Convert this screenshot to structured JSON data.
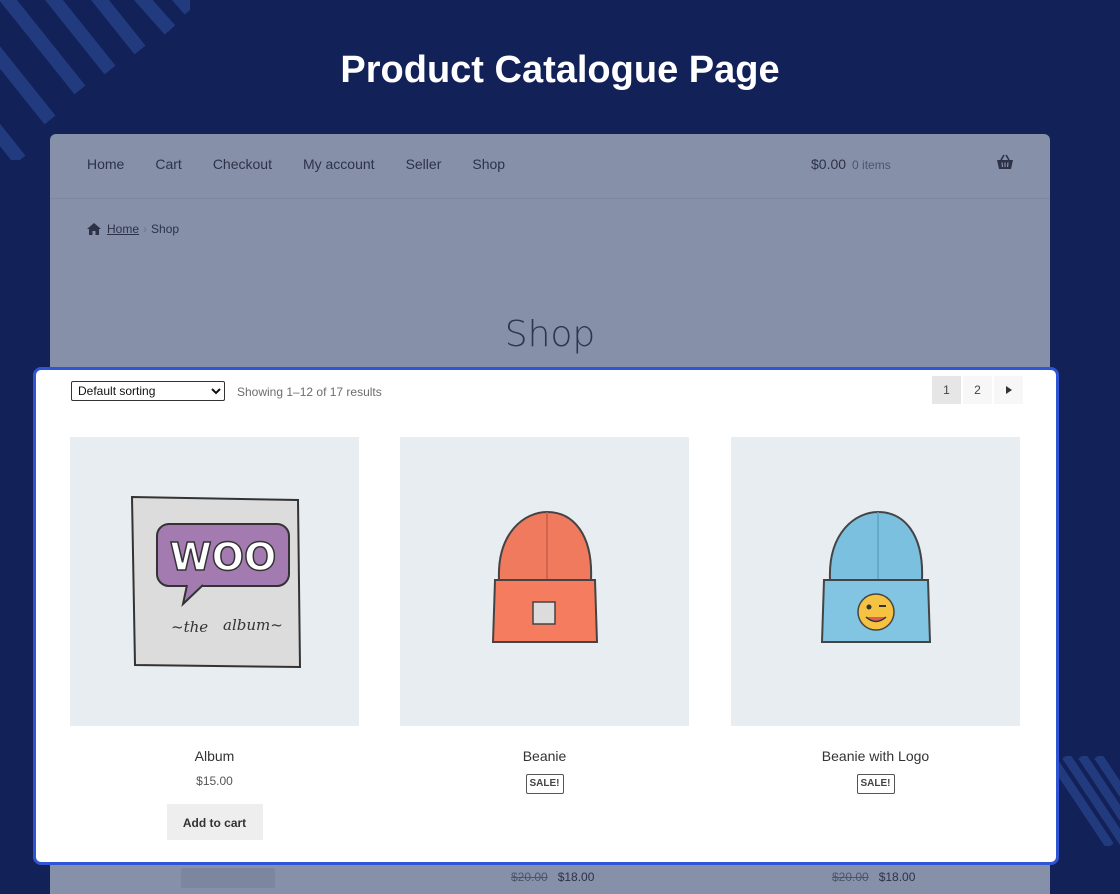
{
  "heading": "Product Catalogue Page",
  "colors": {
    "background": "#122157",
    "overlay": "#8790a9",
    "highlight_border": "#2f55d4",
    "product_bg": "#e8edf1"
  },
  "nav": {
    "items": [
      {
        "label": "Home"
      },
      {
        "label": "Cart"
      },
      {
        "label": "Checkout"
      },
      {
        "label": "My account"
      },
      {
        "label": "Seller"
      },
      {
        "label": "Shop"
      }
    ],
    "cart_total": "$0.00",
    "cart_count": "0 items",
    "cart_icon": "basket-icon"
  },
  "breadcrumb": {
    "home": "Home",
    "separator": "›",
    "current": "Shop",
    "icon": "home-icon"
  },
  "shop_title": "Shop",
  "toolbar": {
    "sort_selected": "Default sorting",
    "result_count": "Showing 1–12 of 17 results",
    "pages": [
      "1",
      "2"
    ],
    "current_page": "1",
    "next_icon": "caret-right-icon"
  },
  "products": [
    {
      "name": "Album",
      "price": "$15.00",
      "button": "Add to cart",
      "image": "woo-album"
    },
    {
      "name": "Beanie",
      "badge": "SALE!",
      "image": "orange-beanie"
    },
    {
      "name": "Beanie with Logo",
      "badge": "SALE!",
      "image": "blue-beanie-logo"
    }
  ],
  "partial_prices": [
    {
      "old": "$20.00",
      "new": "$18.00"
    },
    {
      "old": "$20.00",
      "new": "$18.00"
    }
  ]
}
